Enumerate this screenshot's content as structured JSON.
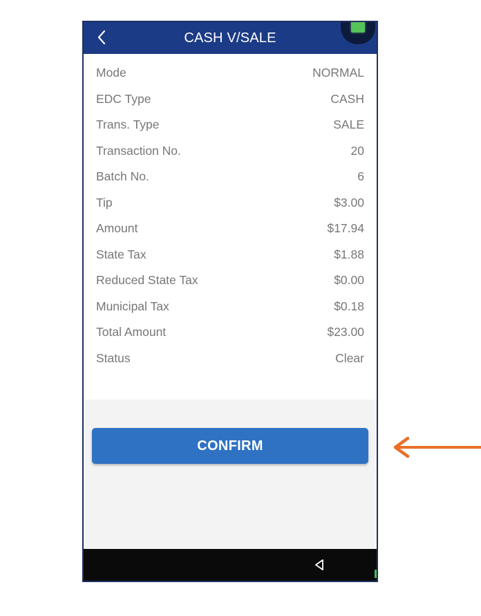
{
  "header": {
    "title": "CASH V/SALE",
    "back_icon": "chevron-left-icon",
    "status_icon": "battery-icon"
  },
  "details": [
    {
      "label": "Mode",
      "value": "NORMAL"
    },
    {
      "label": "EDC Type",
      "value": "CASH"
    },
    {
      "label": "Trans. Type",
      "value": "SALE"
    },
    {
      "label": "Transaction No.",
      "value": "20"
    },
    {
      "label": "Batch No.",
      "value": "6"
    },
    {
      "label": "Tip",
      "value": "$3.00"
    },
    {
      "label": "Amount",
      "value": "$17.94"
    },
    {
      "label": "State Tax",
      "value": "$1.88"
    },
    {
      "label": "Reduced State Tax",
      "value": "$0.00"
    },
    {
      "label": "Municipal Tax",
      "value": "$0.18"
    },
    {
      "label": "Total Amount",
      "value": "$23.00"
    },
    {
      "label": "Status",
      "value": "Clear"
    }
  ],
  "confirm": {
    "label": "CONFIRM"
  },
  "nav": {
    "back_icon": "triangle-back-icon"
  },
  "colors": {
    "header": "#1c3b86",
    "button": "#2f72c4",
    "arrow": "#e8702a",
    "nav_bar": "#0a0a0a"
  }
}
